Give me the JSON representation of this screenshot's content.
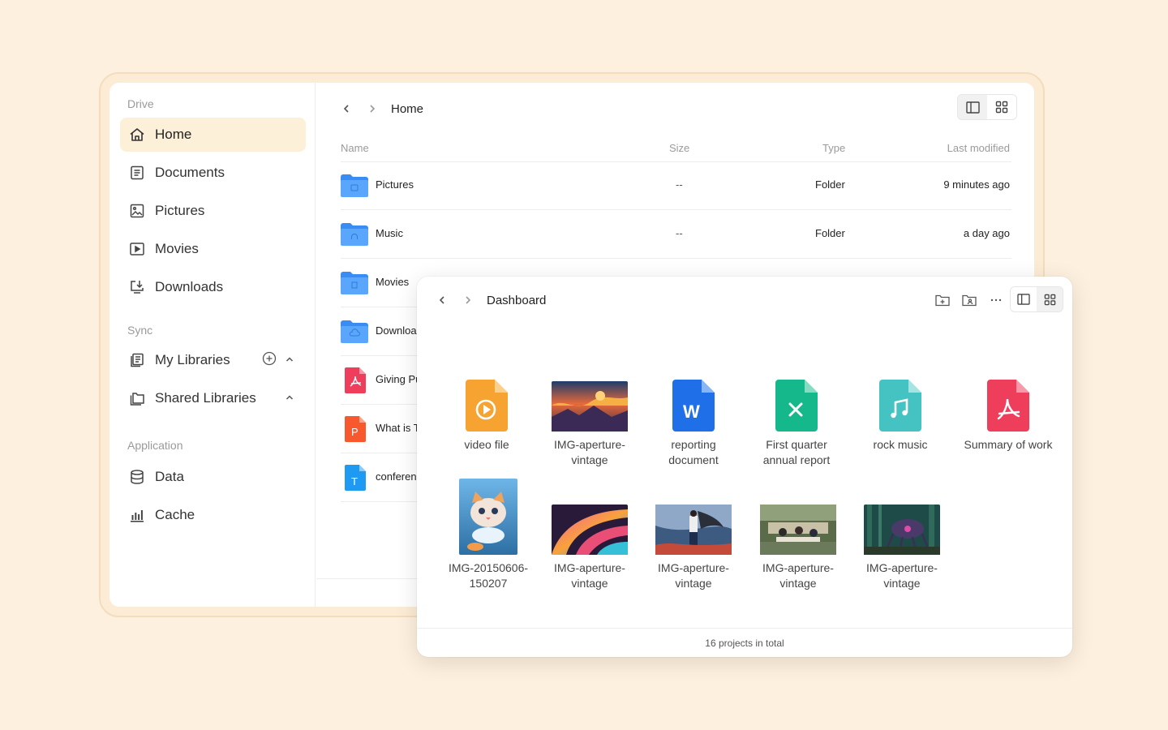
{
  "sidebar": {
    "drive_title": "Drive",
    "drive_items": [
      {
        "label": "Home",
        "icon": "home-icon"
      },
      {
        "label": "Documents",
        "icon": "document-icon"
      },
      {
        "label": "Pictures",
        "icon": "image-icon"
      },
      {
        "label": "Movies",
        "icon": "movie-icon"
      },
      {
        "label": "Downloads",
        "icon": "download-icon"
      }
    ],
    "sync_title": "Sync",
    "sync_items": [
      {
        "label": "My Libraries",
        "icon": "library-icon"
      },
      {
        "label": "Shared Libraries",
        "icon": "shared-folder-icon"
      }
    ],
    "app_title": "Application",
    "app_items": [
      {
        "label": "Data",
        "icon": "database-icon"
      },
      {
        "label": "Cache",
        "icon": "bar-chart-icon"
      }
    ]
  },
  "home": {
    "path": "Home",
    "columns": {
      "name": "Name",
      "size": "Size",
      "type": "Type",
      "modified": "Last modified"
    },
    "rows": [
      {
        "name": "Pictures",
        "size": "--",
        "type": "Folder",
        "modified": "9 minutes ago",
        "icon": "folder-image-icon"
      },
      {
        "name": "Music",
        "size": "--",
        "type": "Folder",
        "modified": "a day ago",
        "icon": "folder-music-icon"
      },
      {
        "name": "Movies",
        "icon": "folder-movie-icon"
      },
      {
        "name": "Downloa",
        "icon": "folder-download-icon"
      },
      {
        "name": "Giving Pu",
        "icon": "pdf-file-icon"
      },
      {
        "name": "What is T",
        "icon": "ppt-file-icon"
      },
      {
        "name": "conferen",
        "icon": "text-file-icon"
      }
    ]
  },
  "dashboard": {
    "path": "Dashboard",
    "tiles": [
      {
        "label": "video file",
        "icon": "video-file-icon",
        "color": "#f7a332"
      },
      {
        "label": "IMG-aperture-vintage",
        "icon": "image-thumbnail"
      },
      {
        "label": "reporting document",
        "icon": "word-file-icon",
        "color": "#1f6fe8"
      },
      {
        "label": "First quarter annual report",
        "icon": "excel-file-icon",
        "color": "#14b88a"
      },
      {
        "label": "rock music",
        "icon": "music-file-icon",
        "color": "#45c3c3"
      },
      {
        "label": "Summary of work",
        "icon": "pdf-file-icon",
        "color": "#ef3e5c"
      },
      {
        "label": "IMG-20150606-150207",
        "icon": "image-thumbnail"
      },
      {
        "label": "IMG-aperture-vintage",
        "icon": "image-thumbnail"
      },
      {
        "label": "IMG-aperture-vintage",
        "icon": "image-thumbnail"
      },
      {
        "label": "IMG-aperture-vintage",
        "icon": "image-thumbnail"
      },
      {
        "label": "IMG-aperture-vintage",
        "icon": "image-thumbnail"
      }
    ],
    "footer": "16 projects in total"
  },
  "colors": {
    "accent_bg": "#fdf0d8",
    "folder": "#4d9dfc",
    "page_bg": "#fdf0de"
  }
}
